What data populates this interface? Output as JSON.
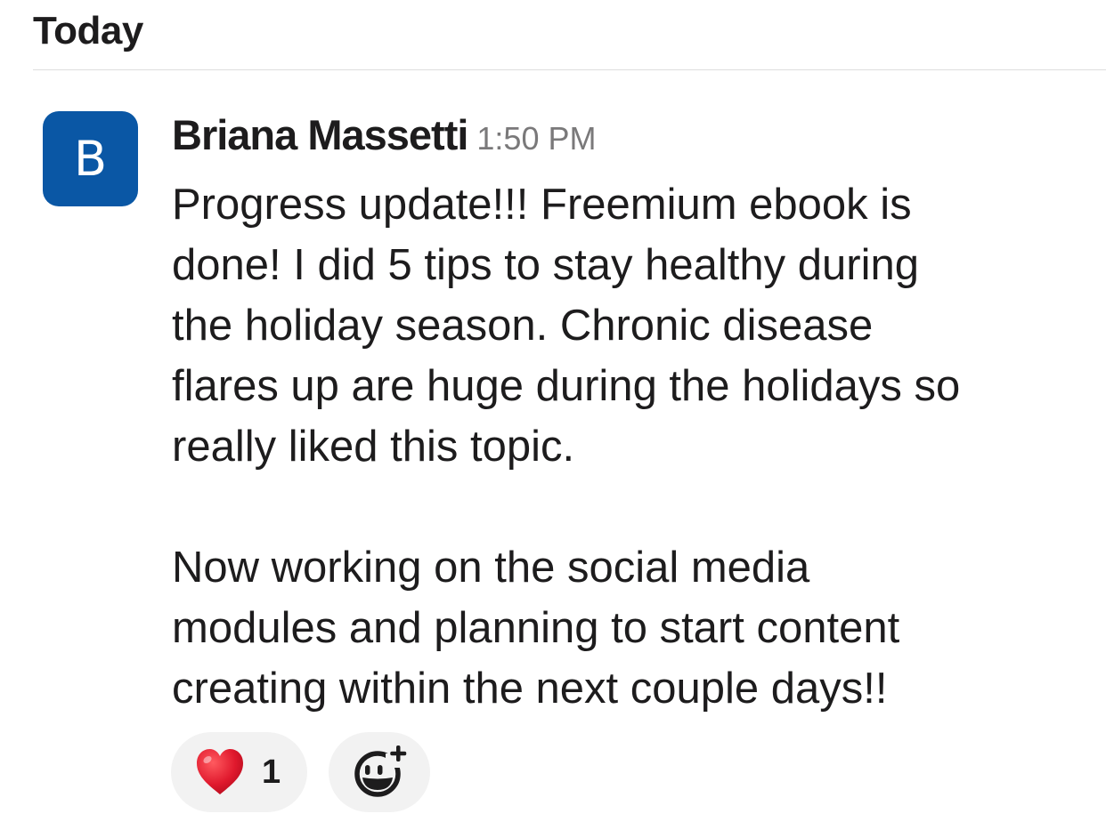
{
  "day_divider": {
    "label": "Today"
  },
  "message": {
    "avatar_letter": "B",
    "sender": "Briana Massetti",
    "time": "1:50 PM",
    "lines": [
      "Progress update!!! Freemium ebook is",
      "done! I did 5 tips to stay healthy during",
      "the holiday season. Chronic disease",
      "flares up are huge during the holidays so",
      "really liked this topic.",
      "Now working on the social media",
      "modules and planning to start content",
      "creating within the next couple days!!"
    ]
  },
  "reactions": [
    {
      "icon": "red-heart-icon",
      "count": "1"
    }
  ],
  "add_reaction": {
    "icon": "add-reaction-icon"
  },
  "colors": {
    "avatar_bg": "#0a57a5",
    "timestamp": "#7a797a",
    "reaction_bg": "#f2f2f2",
    "heart": "#e0192d"
  }
}
